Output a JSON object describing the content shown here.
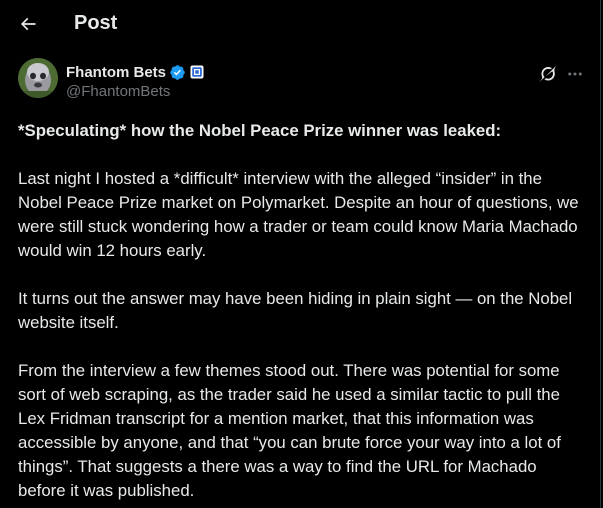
{
  "header": {
    "title": "Post",
    "back_icon": "back-arrow-icon"
  },
  "author": {
    "display_name": "Fhantom Bets",
    "handle": "@FhantomBets",
    "verified_icon": "verified-badge-icon",
    "affiliate_icon": "affiliate-badge-icon",
    "verified_color": "#1d9bf0"
  },
  "actions": {
    "grok_icon": "grok-icon",
    "more_icon": "more-dots-icon"
  },
  "post": {
    "paragraphs": [
      "*Speculating* how the Nobel Peace Prize winner was leaked:",
      "Last night I hosted a *difficult* interview with the alleged “insider” in the Nobel Peace Prize market on Polymarket. Despite an hour of questions, we were still stuck wondering how a trader or team could know Maria Machado would win 12 hours early.",
      "It turns out the answer may have been hiding in plain sight — on the Nobel website itself.",
      "From the interview a few themes stood out. There was potential for some sort of web scraping, as the trader said he used a similar tactic to pull the Lex Fridman transcript for a mention market, that this information was accessible by anyone, and that “you can brute force your way into a lot of things”. That suggests a there was a way to find the URL for Machado before it was published."
    ]
  },
  "colors": {
    "background": "#000000",
    "text": "#e7e9ea",
    "secondary_text": "#71767b",
    "border": "#2f3336"
  }
}
